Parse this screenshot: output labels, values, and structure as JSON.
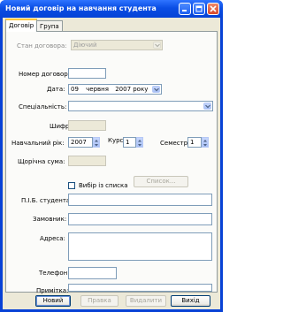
{
  "window": {
    "title": "Новий договір на навчання студента"
  },
  "tabs": [
    {
      "label": "Договір",
      "active": true
    },
    {
      "label": "Група",
      "active": false
    }
  ],
  "form": {
    "status": {
      "label": "Стан договора:",
      "value": "Діючий"
    },
    "contract_number": {
      "label": "Номер договора:",
      "value": ""
    },
    "date": {
      "label": "Дата:",
      "day": "09",
      "month": "червня",
      "year": "2007 року"
    },
    "specialty": {
      "label": "Спеціальність:",
      "value": ""
    },
    "code": {
      "label": "Шифр:",
      "value": ""
    },
    "academic_year": {
      "label": "Навчальний рік:",
      "value": "2007"
    },
    "course": {
      "label": "Курс",
      "value": "1"
    },
    "semester": {
      "label": "Семестр:",
      "value": "1"
    },
    "annual_sum": {
      "label": "Щорічна сума:",
      "value": ""
    },
    "pick_from_list": {
      "label": "Вибір із списка",
      "checked": false
    },
    "list_button": "Список...",
    "student_name": {
      "label": "П.І.Б. студента:",
      "value": ""
    },
    "customer": {
      "label": "Замовник:",
      "value": ""
    },
    "address": {
      "label": "Адреса:",
      "value": ""
    },
    "phone": {
      "label": "Телефон:",
      "value": ""
    },
    "note": {
      "label": "Примітка:",
      "value": ""
    }
  },
  "buttons": {
    "new": "Новий",
    "edit": "Правка",
    "delete": "Видалити",
    "exit": "Вихід"
  },
  "colors": {
    "titlebar": "#0a4ee4",
    "face": "#ece9d8",
    "field_border": "#7f9db9",
    "tab_highlight": "#ffc83c"
  }
}
